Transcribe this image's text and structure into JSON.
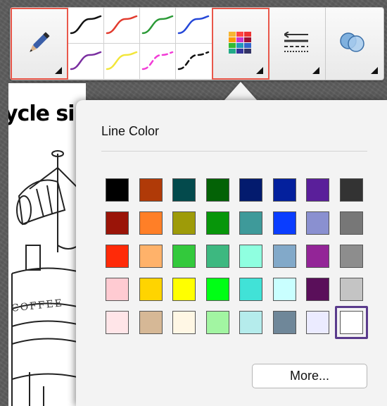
{
  "document": {
    "title_fragment": "ycle si",
    "illustration_text": "COFFEE"
  },
  "toolbar": {
    "pen_tool_icon": "pen-icon",
    "pen_styles": [
      {
        "color": "#111111",
        "style": "solid"
      },
      {
        "color": "#e23b2e",
        "style": "solid"
      },
      {
        "color": "#2b9a37",
        "style": "solid"
      },
      {
        "color": "#2447d8",
        "style": "solid"
      },
      {
        "color": "#7a2ea0",
        "style": "solid"
      },
      {
        "color": "#f2e63a",
        "style": "solid"
      },
      {
        "color": "#f23bd6",
        "style": "dashed"
      },
      {
        "color": "#111111",
        "style": "dashed"
      }
    ],
    "palette_tool_icon": "color-palette-icon",
    "line_style_tool_icon": "line-style-icon",
    "fill_tool_icon": "overlapping-circles-icon",
    "highlight_color": "#e9574a"
  },
  "line_color_popover": {
    "title": "Line Color",
    "more_button": "More...",
    "selected_swatch": "#ffffff",
    "colors": [
      [
        "#000000",
        "#b03a08",
        "#034a4c",
        "#036206",
        "#031b6e",
        "#03209d",
        "#5a1f9a",
        "#333333"
      ],
      [
        "#9a1408",
        "#ff7f27",
        "#9e9b08",
        "#07960a",
        "#3e9a9a",
        "#0a3dff",
        "#8a90d0",
        "#777777"
      ],
      [
        "#ff2a08",
        "#ffb26a",
        "#33c93c",
        "#3db880",
        "#8fffe0",
        "#82a9c9",
        "#932597",
        "#8d8d8d"
      ],
      [
        "#ffcbd2",
        "#ffd400",
        "#ffff00",
        "#00ff15",
        "#41e2d7",
        "#c9ffff",
        "#5a0f5a",
        "#c4c4c4"
      ],
      [
        "#ffe5e8",
        "#d6b896",
        "#fff7e5",
        "#a2f5a2",
        "#b5ecec",
        "#6f8799",
        "#ebebff",
        "#ffffff"
      ]
    ]
  }
}
